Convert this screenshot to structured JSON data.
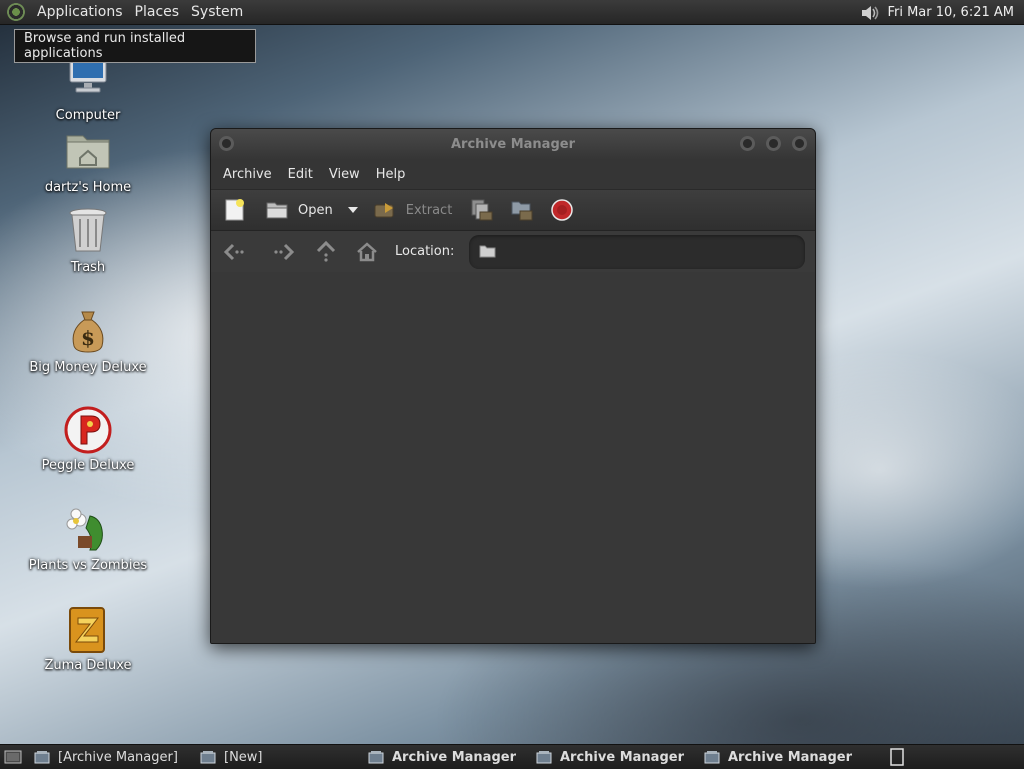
{
  "top_panel": {
    "menus": [
      "Applications",
      "Places",
      "System"
    ],
    "clock": "Fri Mar 10,  6:21 AM",
    "tooltip": "Browse and run installed applications",
    "icons": {
      "logo": "distro-logo-icon",
      "volume": "speaker-icon"
    }
  },
  "desktop": {
    "icons": [
      {
        "label": "Computer",
        "icon": "computer-icon"
      },
      {
        "label": "dartz's Home",
        "icon": "home-folder-icon"
      },
      {
        "label": "Trash",
        "icon": "trash-icon"
      },
      {
        "label": "Big Money Deluxe",
        "icon": "money-bag-icon"
      },
      {
        "label": "Peggle Deluxe",
        "icon": "peggle-icon"
      },
      {
        "label": "Plants vs Zombies",
        "icon": "plants-icon"
      },
      {
        "label": "Zuma Deluxe",
        "icon": "zuma-icon"
      }
    ]
  },
  "window": {
    "title": "Archive Manager",
    "menu": [
      "Archive",
      "Edit",
      "View",
      "Help"
    ],
    "toolbar": {
      "new_icon": "new-archive-icon",
      "open_label": "Open",
      "open_menu_icon": "dropdown-arrow-icon",
      "extract_label": "Extract",
      "add_files_icon": "add-files-icon",
      "add_folder_icon": "add-folder-icon",
      "stop_icon": "stop-icon"
    },
    "location": {
      "label": "Location:",
      "value": "",
      "nav_icons": [
        "back-icon",
        "forward-icon",
        "up-icon",
        "home-icon"
      ]
    }
  },
  "taskbar": {
    "items": [
      "[Archive Manager]",
      "[New]",
      "Archive Manager",
      "Archive Manager",
      "Archive Manager"
    ]
  },
  "colors": {
    "panel": "#2b2b2b",
    "window_bg": "#353535",
    "stop_red": "#c0282a",
    "text": "#e8e8e8",
    "disabled_text": "#8a8a8a"
  }
}
